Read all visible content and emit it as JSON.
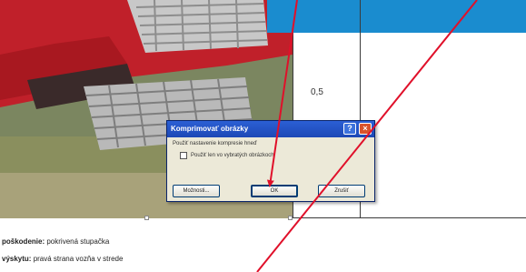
{
  "table": {
    "cell_value": "0,5"
  },
  "caption": {
    "line1_label": "poškodenie:",
    "line1_text": " pokrivená stupačka",
    "line2_label": "výskytu:",
    "line2_text": " pravá strana vozňa v strede"
  },
  "dialog": {
    "title": "Komprimovať obrázky",
    "help_symbol": "?",
    "close_symbol": "×",
    "message": "Použiť nastavenie kompresie hneď",
    "checkbox_label": "Použiť len vo vybratých obrázkoch",
    "options_button": "Možnosti...",
    "ok_button": "OK",
    "cancel_button": "Zrušiť"
  },
  "colors": {
    "arrow": "#e0102a",
    "accent_band": "#1a8ccf",
    "dialog_title": "#1d48b6"
  }
}
